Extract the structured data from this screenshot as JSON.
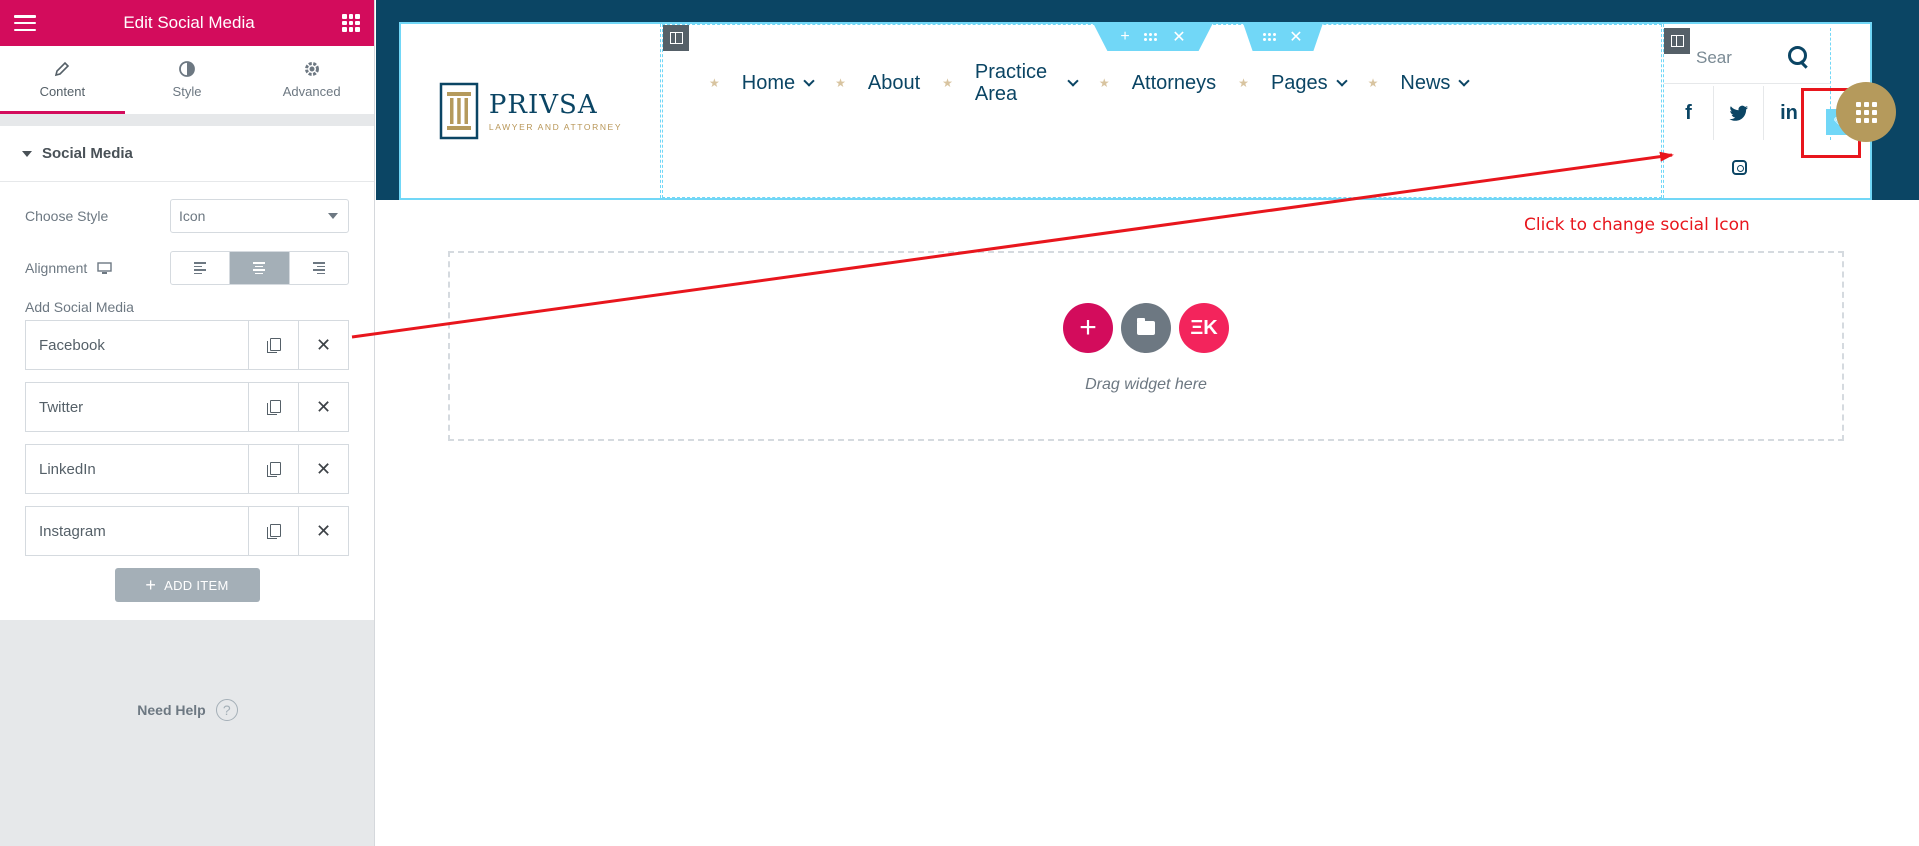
{
  "panel": {
    "title": "Edit Social Media",
    "tabs": [
      {
        "label": "Content",
        "icon": "pencil-icon",
        "active": true
      },
      {
        "label": "Style",
        "icon": "half-circle-icon",
        "active": false
      },
      {
        "label": "Advanced",
        "icon": "gear-icon",
        "active": false
      }
    ],
    "section_title": "Social Media",
    "choose_style_label": "Choose Style",
    "choose_style_value": "Icon",
    "alignment_label": "Alignment",
    "alignment_selected": "center",
    "add_social_label": "Add Social Media",
    "items": [
      "Facebook",
      "Twitter",
      "LinkedIn",
      "Instagram"
    ],
    "add_item_label": "ADD ITEM",
    "need_help_label": "Need Help",
    "accent_color": "#d30c5c"
  },
  "canvas": {
    "logo": {
      "name": "PRIVSA",
      "tagline": "LAWYER AND ATTORNEY"
    },
    "nav": [
      {
        "label": "Home",
        "dropdown": true
      },
      {
        "label": "About",
        "dropdown": false
      },
      {
        "label": "Practice Area",
        "dropdown": true
      },
      {
        "label": "Attorneys",
        "dropdown": false
      },
      {
        "label": "Pages",
        "dropdown": true
      },
      {
        "label": "News",
        "dropdown": true
      }
    ],
    "search_placeholder": "Sear",
    "social_icons": [
      "f",
      "twitter",
      "in",
      "instagram"
    ],
    "callout_text": "Click to change social Icon",
    "dropzone_text": "Drag widget here",
    "header_bg": "#0b4564",
    "gold": "#b59a5c"
  }
}
